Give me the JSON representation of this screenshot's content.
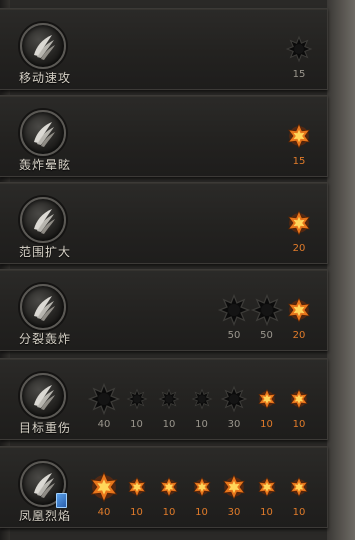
{
  "skills": [
    {
      "name": "移动速攻",
      "has_book": false,
      "stars": [
        {
          "level": "15",
          "active": false,
          "size": "medium"
        }
      ]
    },
    {
      "name": "轰炸晕眩",
      "has_book": false,
      "stars": [
        {
          "level": "15",
          "active": true,
          "size": "medium"
        }
      ]
    },
    {
      "name": "范围扩大",
      "has_book": false,
      "stars": [
        {
          "level": "20",
          "active": true,
          "size": "medium"
        }
      ]
    },
    {
      "name": "分裂轰炸",
      "has_book": false,
      "stars": [
        {
          "level": "50",
          "active": false,
          "size": "large"
        },
        {
          "level": "50",
          "active": false,
          "size": "large"
        },
        {
          "level": "20",
          "active": true,
          "size": "medium"
        }
      ]
    },
    {
      "name": "目标重伤",
      "has_book": false,
      "stars": [
        {
          "level": "40",
          "active": false,
          "size": "large"
        },
        {
          "level": "10",
          "active": false,
          "size": "small"
        },
        {
          "level": "10",
          "active": false,
          "size": "small"
        },
        {
          "level": "10",
          "active": false,
          "size": "small"
        },
        {
          "level": "30",
          "active": false,
          "size": "medium"
        },
        {
          "level": "10",
          "active": true,
          "size": "small"
        },
        {
          "level": "10",
          "active": true,
          "size": "small"
        }
      ]
    },
    {
      "name": "凤凰烈焰",
      "has_book": true,
      "stars": [
        {
          "level": "40",
          "active": true,
          "size": "large"
        },
        {
          "level": "10",
          "active": true,
          "size": "small"
        },
        {
          "level": "10",
          "active": true,
          "size": "small"
        },
        {
          "level": "10",
          "active": true,
          "size": "small"
        },
        {
          "level": "30",
          "active": true,
          "size": "medium"
        },
        {
          "level": "10",
          "active": true,
          "size": "small"
        },
        {
          "level": "10",
          "active": true,
          "size": "small"
        }
      ]
    }
  ],
  "colors": {
    "active_star_outer": "#e8761c",
    "active_star_inner": "#ffd65a",
    "inactive_star": "#0b0b0b",
    "active_level_text": "#e07b2a",
    "inactive_level_text": "#9a968d"
  },
  "icon": "feather-claw-icon"
}
